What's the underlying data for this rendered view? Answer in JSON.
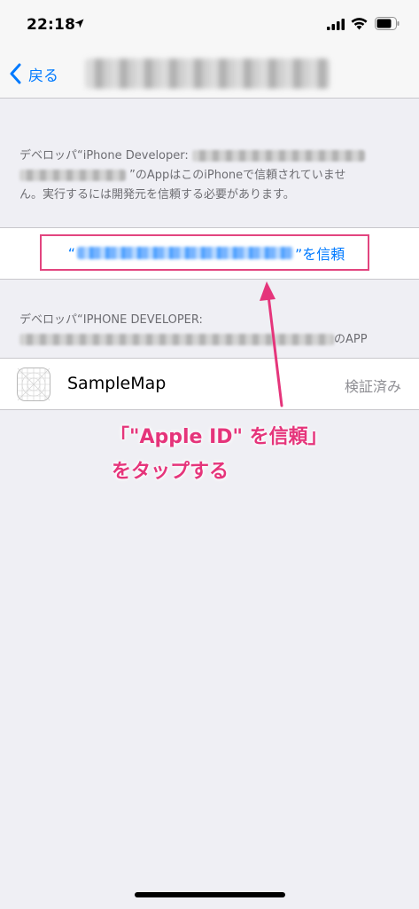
{
  "status_bar": {
    "time": "22:18"
  },
  "nav": {
    "back_label": "戻る"
  },
  "trust_section": {
    "footer_prefix": "デベロッパ“iPhone Developer:",
    "footer_middle": "”のAppはこのiPhoneで信頼されていませ",
    "footer_end": "ん。実行するには開発元を信頼する必要があります。",
    "trust_open_quote": "“",
    "trust_suffix": "”を信頼"
  },
  "apps_section": {
    "header_prefix": "デベロッパ“IPHONE DEVELOPER:",
    "header_suffix": "のAPP",
    "app_name": "SampleMap",
    "app_status": "検証済み"
  },
  "annotation": {
    "line1": "「\"Apple ID\" を信頼」",
    "line2": "をタップする"
  },
  "colors": {
    "accent": "#007aff",
    "annotation": "#e5357b",
    "background": "#efeff4"
  }
}
